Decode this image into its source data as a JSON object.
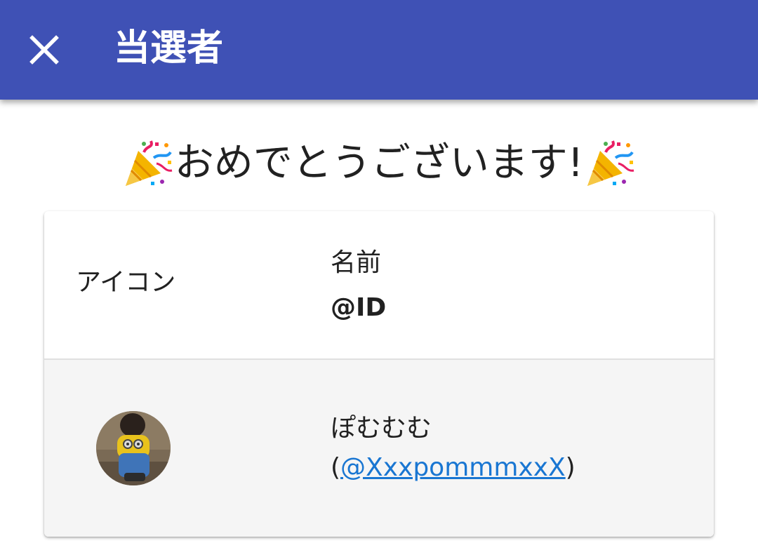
{
  "app_bar": {
    "title": "当選者",
    "close_icon": "close-icon",
    "background_color": "#3f51b5"
  },
  "headline": {
    "text": "おめでとうございます!",
    "decoration_icon": "party-popper-icon"
  },
  "table": {
    "headers": {
      "icon": "アイコン",
      "name": "名前",
      "id": "@ID"
    },
    "rows": [
      {
        "avatar": "winner-avatar",
        "name": "ぽむむむ",
        "id_open": "(",
        "id_link": "@XxxpommmxxX",
        "id_close": ")"
      }
    ]
  },
  "colors": {
    "accent": "#3f51b5",
    "link": "#1976d2",
    "row_background": "#f5f5f5"
  }
}
